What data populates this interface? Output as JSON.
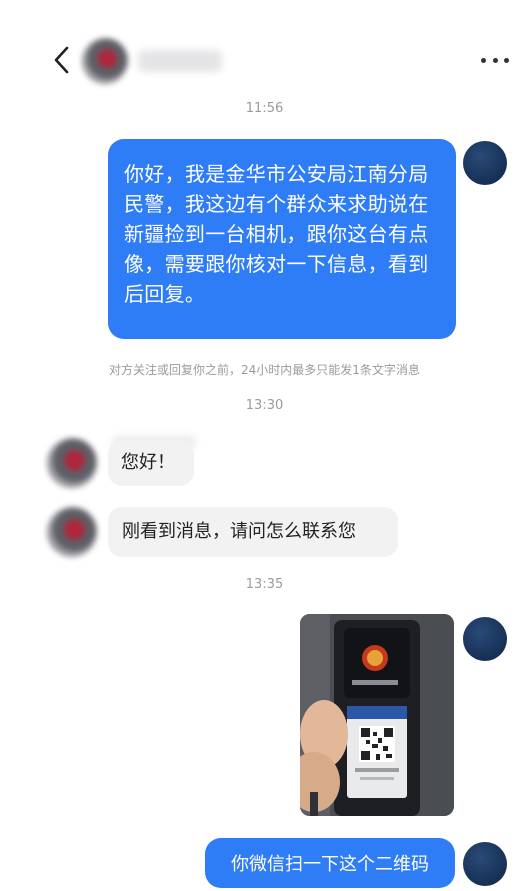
{
  "header": {
    "back_icon": "chevron-left-icon",
    "more_icon": "more-horizontal-icon"
  },
  "chat": {
    "time1": "11:56",
    "msg1": "你好，我是金华市公安局江南分局民警，我这边有个群众来求助说在新疆捡到一台相机，跟你这台有点像，需要跟你核对一下信息，看到后回复。",
    "notice": "对方关注或回复你之前，24小时内最多只能发1条文字消息",
    "time2": "13:30",
    "msg2": "您好！",
    "msg3": "刚看到消息，请问怎么联系您",
    "time3": "13:35",
    "photo_icon": "police-badge-qr-card-photo",
    "msg4": "你微信扫一下这个二维码"
  },
  "colors": {
    "outgoing_bubble": "#2f7df6",
    "incoming_bubble": "#f2f2f2",
    "timestamp": "#9b9b9b"
  }
}
